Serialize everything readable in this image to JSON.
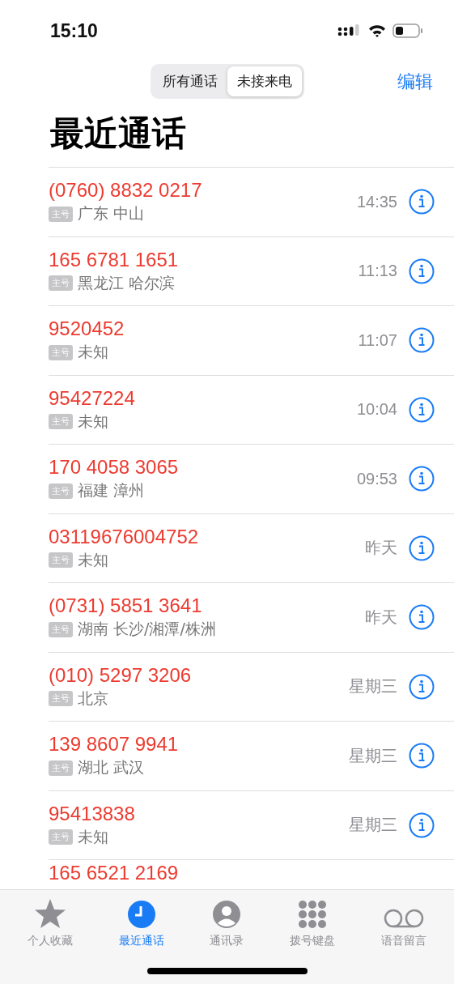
{
  "status_bar": {
    "time": "15:10"
  },
  "segments": [
    {
      "label": "所有通话",
      "selected": false
    },
    {
      "label": "未接来电",
      "selected": true
    }
  ],
  "edit_button": "编辑",
  "title": "最近通话",
  "calls": [
    {
      "number": "(0760) 8832 0217",
      "badge": "主号",
      "location": "广东 中山",
      "time": "14:35"
    },
    {
      "number": "165 6781 1651",
      "badge": "主号",
      "location": "黑龙江 哈尔滨",
      "time": "11:13"
    },
    {
      "number": "9520452",
      "badge": "主号",
      "location": "未知",
      "time": "11:07"
    },
    {
      "number": "95427224",
      "badge": "主号",
      "location": "未知",
      "time": "10:04"
    },
    {
      "number": "170 4058 3065",
      "badge": "主号",
      "location": "福建 漳州",
      "time": "09:53"
    },
    {
      "number": "03119676004752",
      "badge": "主号",
      "location": "未知",
      "time": "昨天"
    },
    {
      "number": "(0731) 5851 3641",
      "badge": "主号",
      "location": "湖南 长沙/湘潭/株洲",
      "time": "昨天"
    },
    {
      "number": "(010) 5297 3206",
      "badge": "主号",
      "location": "北京",
      "time": "星期三"
    },
    {
      "number": "139 8607 9941",
      "badge": "主号",
      "location": "湖北 武汉",
      "time": "星期三"
    },
    {
      "number": "95413838",
      "badge": "主号",
      "location": "未知",
      "time": "星期三"
    },
    {
      "number": "165 6521 2169"
    }
  ],
  "tab_bar": [
    {
      "label": "个人收藏",
      "kind": "star",
      "selected": false
    },
    {
      "label": "最近通话",
      "kind": "clock",
      "selected": true
    },
    {
      "label": "通讯录",
      "kind": "person",
      "selected": false
    },
    {
      "label": "拨号键盘",
      "kind": "keypad",
      "selected": false
    },
    {
      "label": "语音留言",
      "kind": "voicemail",
      "selected": false
    }
  ]
}
